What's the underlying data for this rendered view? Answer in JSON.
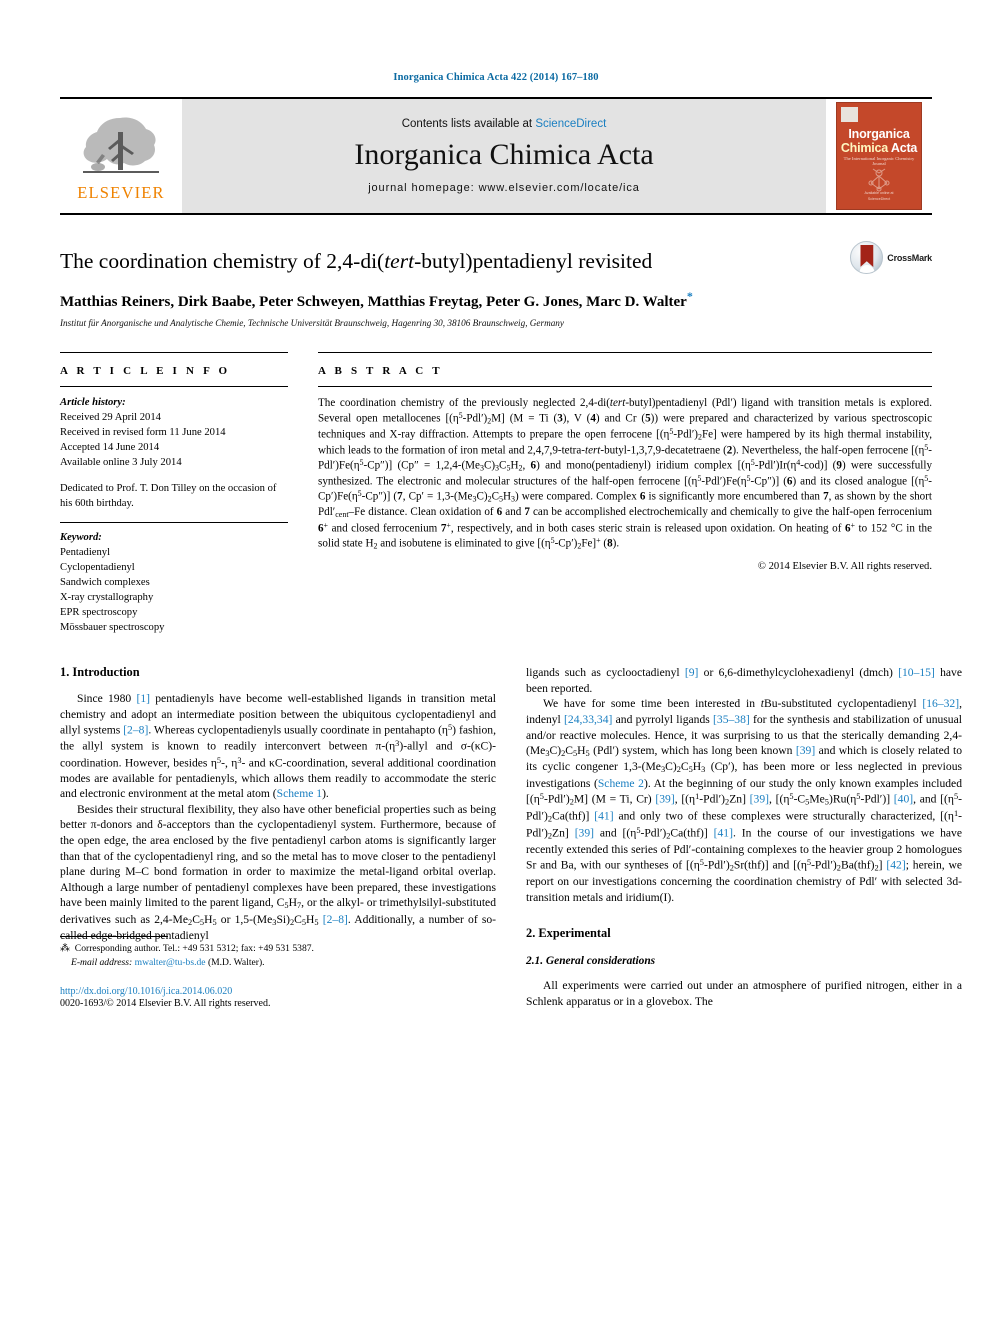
{
  "running_head": "Inorganica Chimica Acta 422 (2014) 167–180",
  "masthead": {
    "publisher_name": "ELSEVIER",
    "contents_prefix": "Contents lists available at ",
    "contents_link": "ScienceDirect",
    "journal_title": "Inorganica Chimica Acta",
    "homepage": "journal homepage: www.elsevier.com/locate/ica",
    "cover": {
      "line1": "Inorganica",
      "line2_a": "Chimica",
      "line2_b": "Acta",
      "subtitle": "The International Inorganic Chemistry Journal",
      "footer": "Published by\nElsevier"
    }
  },
  "title_block": {
    "title_part1": "The coordination chemistry of 2,4-di(",
    "title_italic": "tert",
    "title_part2": "-butyl)pentadienyl revisited",
    "authors": "Matthias Reiners, Dirk Baabe, Peter Schweyen, Matthias Freytag, Peter G. Jones, Marc D. Walter",
    "corresponding_marker": "*",
    "affiliation": "Institut für Anorganische und Analytische Chemie, Technische Universität Braunschweig, Hagenring 30, 38106 Braunschweig, Germany",
    "crossmark_label": "CrossMark"
  },
  "article_info": {
    "heading": "A R T I C L E   I N F O",
    "history_label": "Article history:",
    "history": [
      "Received 29 April 2014",
      "Received in revised form 11 June 2014",
      "Accepted 14 June 2014",
      "Available online 3 July 2014"
    ],
    "dedication": "Dedicated to Prof. T. Don Tilley on the occasion of his 60th birthday.",
    "keywords_label": "Keyword:",
    "keywords": [
      "Pentadienyl",
      "Cyclopentadienyl",
      "Sandwich complexes",
      "X-ray crystallography",
      "EPR spectroscopy",
      "Mössbauer spectroscopy"
    ]
  },
  "abstract": {
    "heading": "A B S T R A C T",
    "copyright": "© 2014 Elsevier B.V. All rights reserved."
  },
  "sections": {
    "intro_heading": "1. Introduction",
    "experimental_heading": "2. Experimental",
    "general_heading": "2.1. General considerations"
  },
  "footnote": {
    "corresponding": "Corresponding author. Tel.: +49 531 5312; fax: +49 531 5387.",
    "email_label": "E-mail address:",
    "email": "mwalter@tu-bs.de",
    "email_suffix": "(M.D. Walter).",
    "doi": "http://dx.doi.org/10.1016/j.ica.2014.06.020",
    "issn": "0020-1693/© 2014 Elsevier B.V. All rights reserved."
  },
  "colors": {
    "link_blue": "#1a7fc1",
    "elsevier_orange": "#ef8200",
    "cover_red": "#c4482a",
    "masthead_grey": "#e3e3e3"
  }
}
